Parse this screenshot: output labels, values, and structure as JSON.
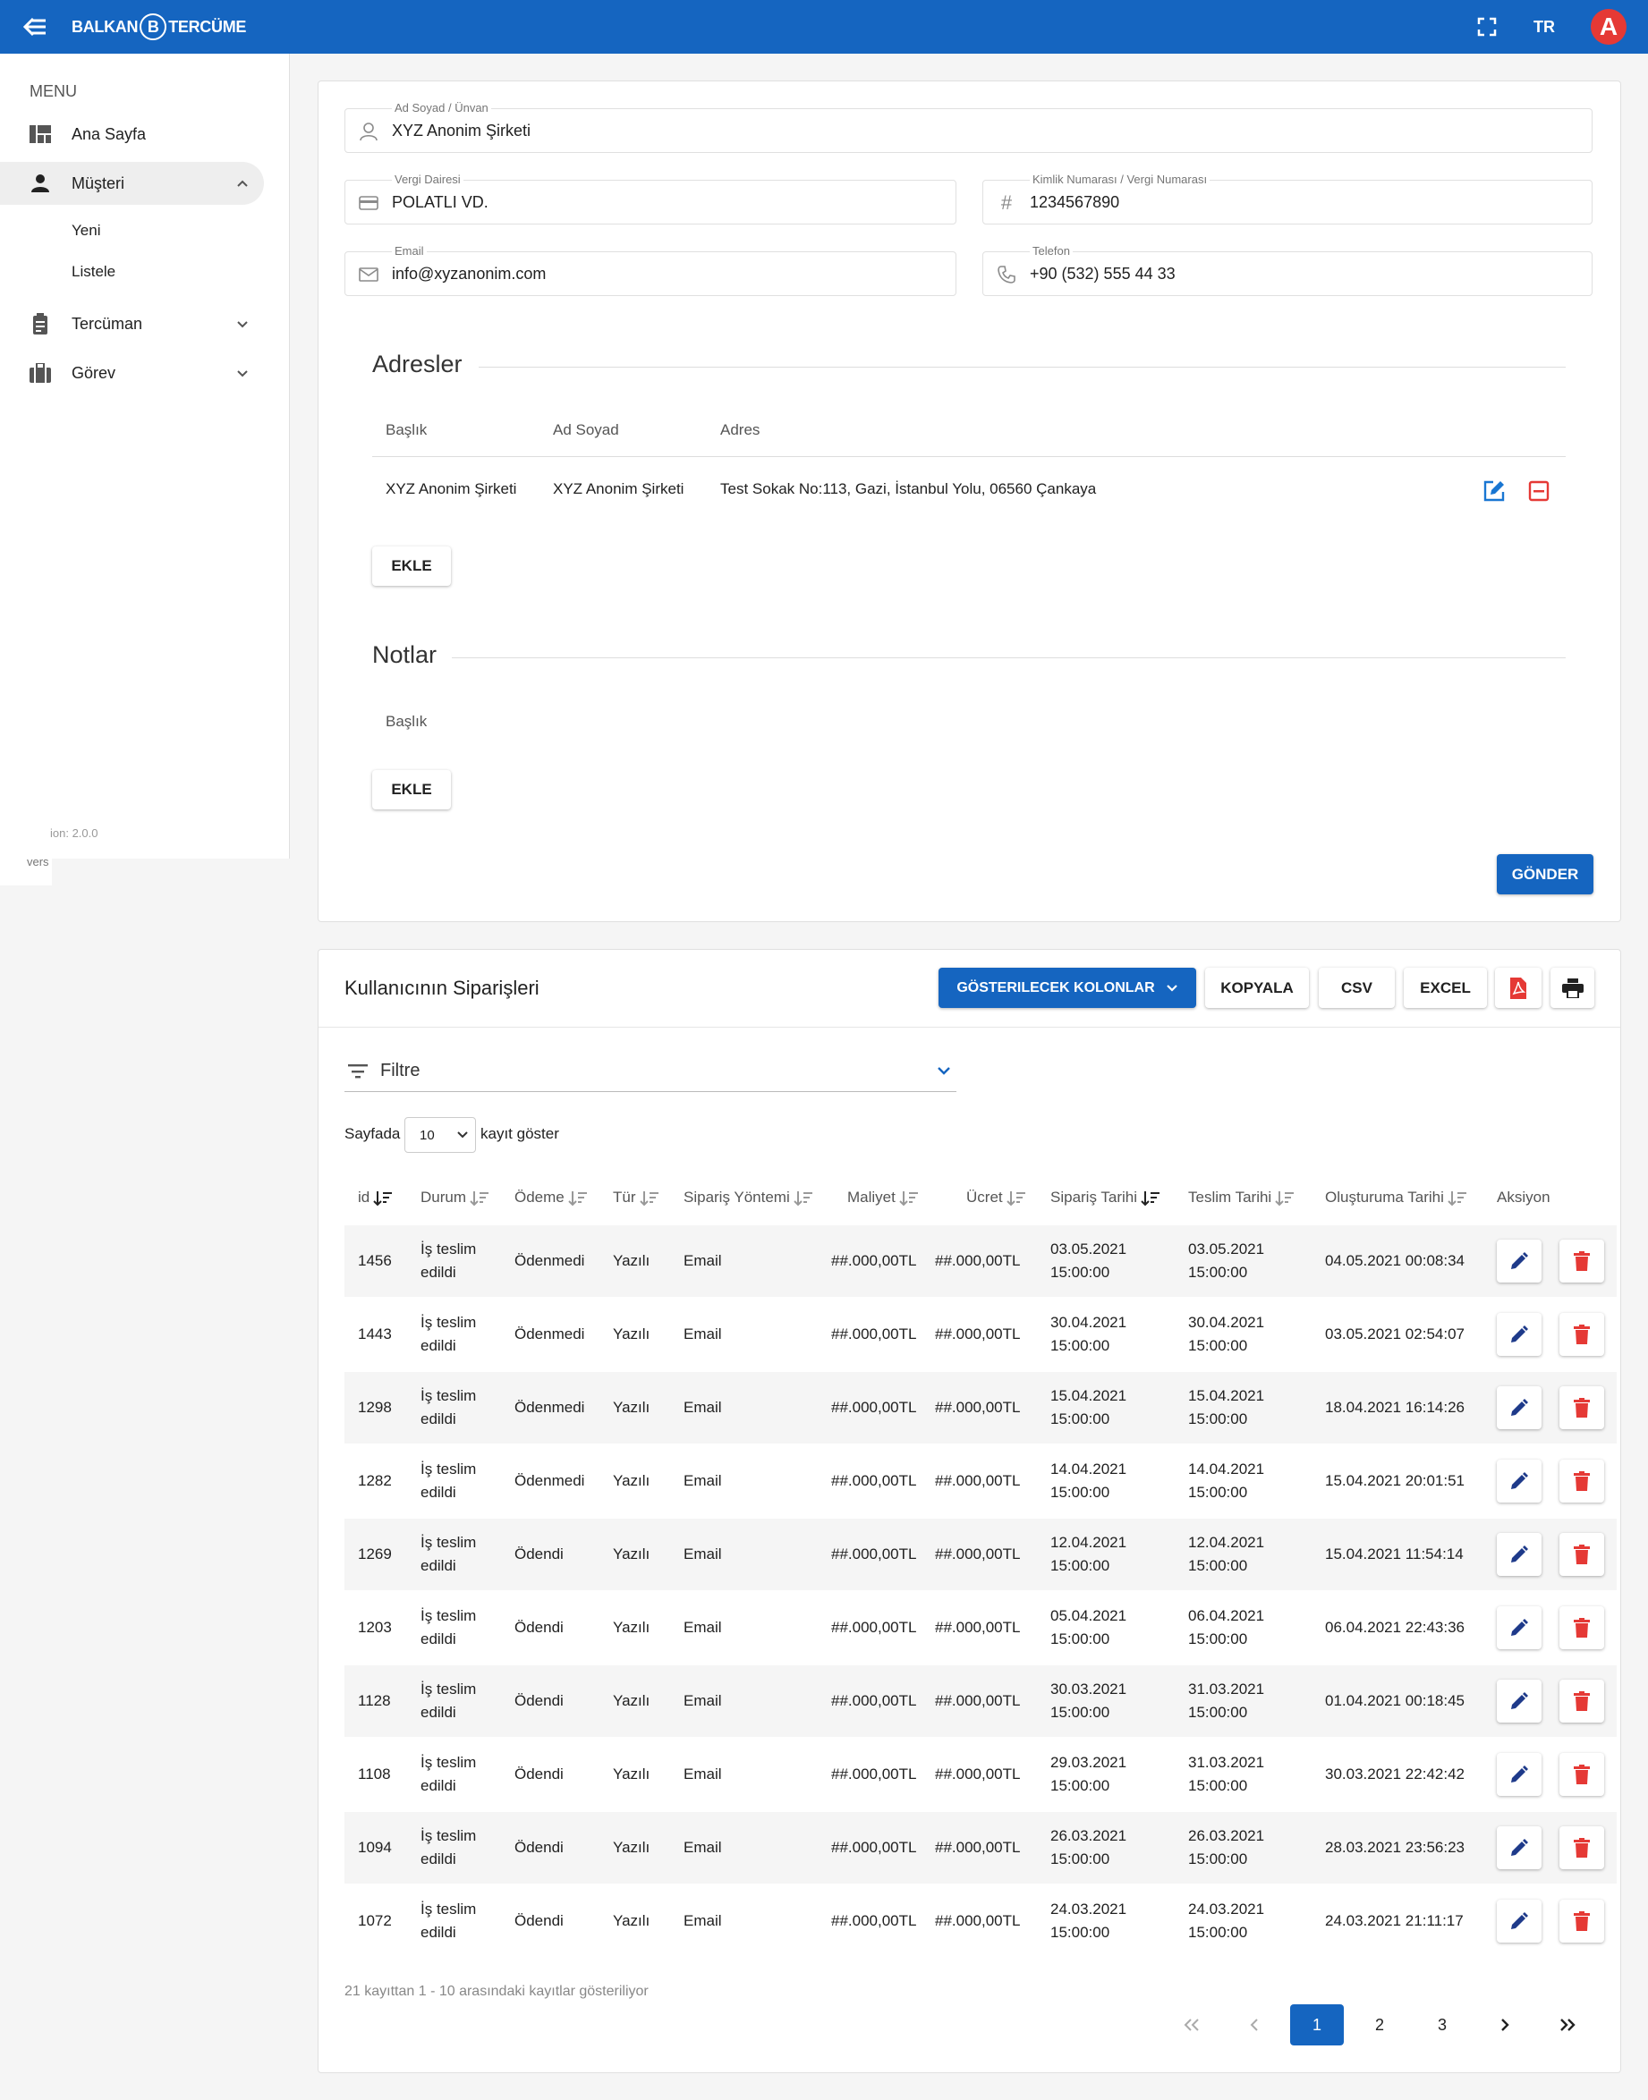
{
  "topbar": {
    "logo_left": "BALKAN",
    "logo_mid": "B",
    "logo_right": "TERCÜME",
    "lang": "TR",
    "avatar": "A"
  },
  "sidebar": {
    "menu_header": "MENU",
    "items": [
      {
        "label": "Ana Sayfa",
        "icon": "dashboard-icon"
      },
      {
        "label": "Müşteri",
        "icon": "person-icon",
        "active": true,
        "expanded": true,
        "children": [
          {
            "label": "Yeni"
          },
          {
            "label": "Listele"
          }
        ]
      },
      {
        "label": "Tercüman",
        "icon": "clipboard-icon"
      },
      {
        "label": "Görev",
        "icon": "briefcase-icon"
      }
    ],
    "version_line1": "ion: 2.0.0",
    "version_line2": "vers"
  },
  "form": {
    "name": {
      "label": "Ad Soyad / Ünvan",
      "value": "XYZ Anonim Şirketi"
    },
    "tax_office": {
      "label": "Vergi Dairesi",
      "value": "POLATLI VD."
    },
    "tax_id": {
      "label": "Kimlik Numarası / Vergi Numarası",
      "value": "1234567890"
    },
    "email": {
      "label": "Email",
      "value": "info@xyzanonim.com"
    },
    "phone": {
      "label": "Telefon",
      "value": "+90 (532) 555 44 33"
    }
  },
  "addresses": {
    "title": "Adresler",
    "columns": [
      "Başlık",
      "Ad Soyad",
      "Adres"
    ],
    "rows": [
      {
        "title": "XYZ Anonim Şirketi",
        "name": "XYZ Anonim Şirketi",
        "address": "Test Sokak No:113, Gazi, İstanbul Yolu, 06560 Çankaya"
      }
    ],
    "add_label": "EKLE"
  },
  "notes": {
    "title": "Notlar",
    "columns": [
      "Başlık"
    ],
    "add_label": "EKLE"
  },
  "submit_label": "GÖNDER",
  "orders": {
    "title": "Kullanıcının Siparişleri",
    "toolbar": {
      "columns_label": "GÖSTERILECEK KOLONLAR",
      "copy": "KOPYALA",
      "csv": "CSV",
      "excel": "EXCEL"
    },
    "filter_label": "Filtre",
    "page_size_prefix": "Sayfada",
    "page_size": "10",
    "page_size_suffix": "kayıt göster",
    "columns": [
      "id",
      "Durum",
      "Ödeme",
      "Tür",
      "Sipariş Yöntemi",
      "Maliyet",
      "Ücret",
      "Sipariş Tarihi",
      "Teslim Tarihi",
      "Oluşturuma Tarihi",
      "Aksiyon"
    ],
    "rows": [
      {
        "id": "1456",
        "status1": "İş teslim",
        "status2": "edildi",
        "payment": "Ödenmedi",
        "type": "Yazılı",
        "method": "Email",
        "cost": "##.000,00TL",
        "fee": "##.000,00TL",
        "order_date": "03.05.2021",
        "order_time": "15:00:00",
        "delivery_date": "03.05.2021",
        "delivery_time": "15:00:00",
        "created": "04.05.2021 00:08:34"
      },
      {
        "id": "1443",
        "status1": "İş teslim",
        "status2": "edildi",
        "payment": "Ödenmedi",
        "type": "Yazılı",
        "method": "Email",
        "cost": "##.000,00TL",
        "fee": "##.000,00TL",
        "order_date": "30.04.2021",
        "order_time": "15:00:00",
        "delivery_date": "30.04.2021",
        "delivery_time": "15:00:00",
        "created": "03.05.2021 02:54:07"
      },
      {
        "id": "1298",
        "status1": "İş teslim",
        "status2": "edildi",
        "payment": "Ödenmedi",
        "type": "Yazılı",
        "method": "Email",
        "cost": "##.000,00TL",
        "fee": "##.000,00TL",
        "order_date": "15.04.2021",
        "order_time": "15:00:00",
        "delivery_date": "15.04.2021",
        "delivery_time": "15:00:00",
        "created": "18.04.2021 16:14:26"
      },
      {
        "id": "1282",
        "status1": "İş teslim",
        "status2": "edildi",
        "payment": "Ödenmedi",
        "type": "Yazılı",
        "method": "Email",
        "cost": "##.000,00TL",
        "fee": "##.000,00TL",
        "order_date": "14.04.2021",
        "order_time": "15:00:00",
        "delivery_date": "14.04.2021",
        "delivery_time": "15:00:00",
        "created": "15.04.2021 20:01:51"
      },
      {
        "id": "1269",
        "status1": "İş teslim",
        "status2": "edildi",
        "payment": "Ödendi",
        "type": "Yazılı",
        "method": "Email",
        "cost": "##.000,00TL",
        "fee": "##.000,00TL",
        "order_date": "12.04.2021",
        "order_time": "15:00:00",
        "delivery_date": "12.04.2021",
        "delivery_time": "15:00:00",
        "created": "15.04.2021 11:54:14"
      },
      {
        "id": "1203",
        "status1": "İş teslim",
        "status2": "edildi",
        "payment": "Ödendi",
        "type": "Yazılı",
        "method": "Email",
        "cost": "##.000,00TL",
        "fee": "##.000,00TL",
        "order_date": "05.04.2021",
        "order_time": "15:00:00",
        "delivery_date": "06.04.2021",
        "delivery_time": "15:00:00",
        "created": "06.04.2021 22:43:36"
      },
      {
        "id": "1128",
        "status1": "İş teslim",
        "status2": "edildi",
        "payment": "Ödendi",
        "type": "Yazılı",
        "method": "Email",
        "cost": "##.000,00TL",
        "fee": "##.000,00TL",
        "order_date": "30.03.2021",
        "order_time": "15:00:00",
        "delivery_date": "31.03.2021",
        "delivery_time": "15:00:00",
        "created": "01.04.2021 00:18:45"
      },
      {
        "id": "1108",
        "status1": "İş teslim",
        "status2": "edildi",
        "payment": "Ödendi",
        "type": "Yazılı",
        "method": "Email",
        "cost": "##.000,00TL",
        "fee": "##.000,00TL",
        "order_date": "29.03.2021",
        "order_time": "15:00:00",
        "delivery_date": "31.03.2021",
        "delivery_time": "15:00:00",
        "created": "30.03.2021 22:42:42"
      },
      {
        "id": "1094",
        "status1": "İş teslim",
        "status2": "edildi",
        "payment": "Ödendi",
        "type": "Yazılı",
        "method": "Email",
        "cost": "##.000,00TL",
        "fee": "##.000,00TL",
        "order_date": "26.03.2021",
        "order_time": "15:00:00",
        "delivery_date": "26.03.2021",
        "delivery_time": "15:00:00",
        "created": "28.03.2021 23:56:23"
      },
      {
        "id": "1072",
        "status1": "İş teslim",
        "status2": "edildi",
        "payment": "Ödendi",
        "type": "Yazılı",
        "method": "Email",
        "cost": "##.000,00TL",
        "fee": "##.000,00TL",
        "order_date": "24.03.2021",
        "order_time": "15:00:00",
        "delivery_date": "24.03.2021",
        "delivery_time": "15:00:00",
        "created": "24.03.2021 21:11:17"
      }
    ],
    "summary": "21 kayıttan 1 - 10 arasındaki kayıtlar gösteriliyor",
    "pagination": {
      "pages": [
        "1",
        "2",
        "3"
      ],
      "current": "1"
    }
  },
  "colors": {
    "primary": "#1565c0",
    "danger": "#e53935",
    "edit": "#1e3a8a"
  }
}
